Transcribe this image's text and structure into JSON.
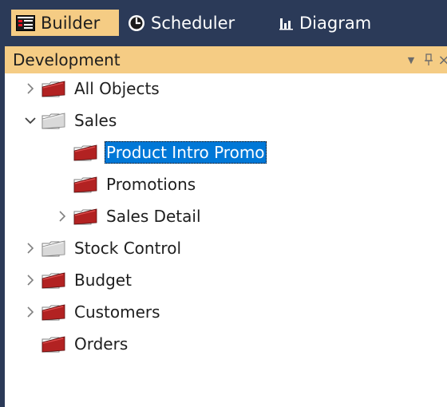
{
  "tabs": [
    {
      "label": "Builder",
      "icon": "builder-icon",
      "active": true
    },
    {
      "label": "Scheduler",
      "icon": "clock-icon",
      "active": false
    },
    {
      "label": "Diagram",
      "icon": "bar-chart-icon",
      "active": false
    }
  ],
  "panel": {
    "title": "Development",
    "controls": [
      "dropdown-arrow-icon",
      "pin-icon",
      "close-icon"
    ]
  },
  "tree": [
    {
      "label": "All Objects",
      "level": 0,
      "expander": "collapsed",
      "folder": "red"
    },
    {
      "label": "Sales",
      "level": 0,
      "expander": "expanded",
      "folder": "gray"
    },
    {
      "label": "Product Intro Promo",
      "level": 1,
      "expander": "none",
      "folder": "red",
      "selected": true
    },
    {
      "label": "Promotions",
      "level": 1,
      "expander": "none",
      "folder": "red"
    },
    {
      "label": "Sales Detail",
      "level": 1,
      "expander": "collapsed",
      "folder": "red"
    },
    {
      "label": "Stock Control",
      "level": 0,
      "expander": "collapsed",
      "folder": "gray"
    },
    {
      "label": "Budget",
      "level": 0,
      "expander": "collapsed",
      "folder": "red"
    },
    {
      "label": "Customers",
      "level": 0,
      "expander": "collapsed",
      "folder": "red"
    },
    {
      "label": "Orders",
      "level": 0,
      "expander": "none",
      "folder": "red"
    }
  ],
  "colors": {
    "tabbar_bg": "#2b3a58",
    "active_tab_bg": "#f5cc84",
    "selection_bg": "#0078d7",
    "folder_red": "#b22222",
    "folder_gray": "#d9d9d9"
  }
}
